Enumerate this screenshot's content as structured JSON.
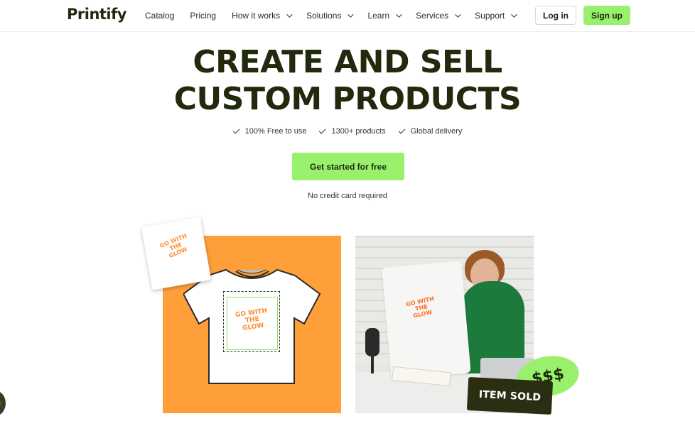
{
  "brand": {
    "name": "Printify"
  },
  "nav": {
    "links": [
      {
        "label": "Catalog",
        "dropdown": false
      },
      {
        "label": "Pricing",
        "dropdown": false
      },
      {
        "label": "How it works",
        "dropdown": true
      },
      {
        "label": "Solutions",
        "dropdown": true
      },
      {
        "label": "Learn",
        "dropdown": true
      },
      {
        "label": "Services",
        "dropdown": true
      },
      {
        "label": "Support",
        "dropdown": true
      }
    ],
    "login_label": "Log in",
    "signup_label": "Sign up"
  },
  "hero": {
    "headline_line1": "CREATE AND SELL",
    "headline_line2": "CUSTOM PRODUCTS",
    "features": [
      "100% Free to use",
      "1300+ products",
      "Global delivery"
    ],
    "cta_label": "Get started for free",
    "cta_note": "No credit card required"
  },
  "visuals": {
    "design_text": "GO WITH THE GLOW",
    "money_text": "$$$",
    "item_sold_text": "ITEM SOLD"
  },
  "colors": {
    "accent_green": "#99f06c",
    "headline": "#222a0d",
    "orange_panel": "#ff9f3a",
    "dark_badge": "#2b2e12"
  }
}
